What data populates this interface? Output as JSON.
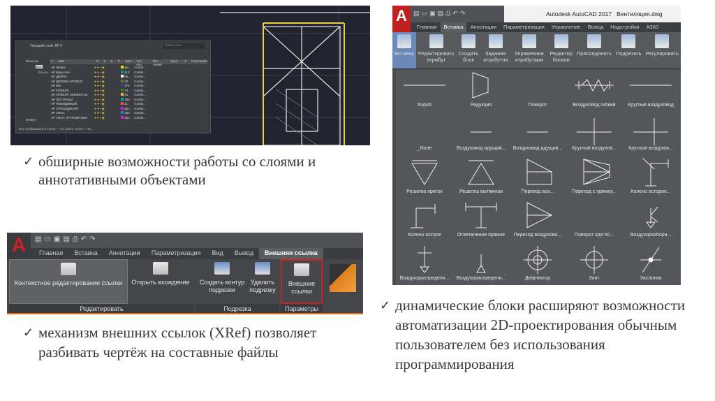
{
  "layers_panel": {
    "title": "Текущий слой: АР 0",
    "search_placeholder": "Поиск слоя",
    "filter_header": "Фильтры",
    "filter_all": "Все",
    "filter_used": "Все ис...",
    "invert_label": "Инверт",
    "columns": [
      "С.",
      "Имя",
      "В.",
      "З.",
      "Б.",
      "П.",
      "Цвет",
      "Тип лин...",
      "Вес линий",
      "Проз...",
      "З.",
      "Пояснение"
    ],
    "rows": [
      {
        "name": "АР Мебел",
        "color": "#e8e800",
        "color_label": "же..."
      },
      {
        "name": "АР Ведостен",
        "color": "#00a080",
        "color_label": "112"
      },
      {
        "name": "АР ДВЕРИ",
        "color": "#ffffff",
        "color_label": "бе..."
      },
      {
        "name": "АР ДЕРЕВО КРОВЛЯ",
        "color": "#8a6a30",
        "color_label": "33"
      },
      {
        "name": "АР ВЫ",
        "color": "#3040a0",
        "color_label": "171"
      },
      {
        "name": "АР КРОВЛЯ",
        "color": "#2a8a20",
        "color_label": "74"
      },
      {
        "name": "АР КРОВЛЯ ЭЛЕМЕНТЫ",
        "color": "#e0c040",
        "color_label": "41"
      },
      {
        "name": "АР ЛЕСТНИЦА",
        "color": "#00a0b0",
        "color_label": "152"
      },
      {
        "name": "АР НЕВИДИМЫЙ",
        "color": "#e05050",
        "color_label": "11"
      },
      {
        "name": "АР ОГРАЖДЕНИЯ",
        "color": "#d020d0",
        "color_label": "фи..."
      },
      {
        "name": "АР ОКНА",
        "color": "#2080d0",
        "color_label": "150"
      },
      {
        "name": "АР ОКНА ОТКРЫВАНИЕ",
        "color": "#d020d0",
        "color_label": "фи..."
      }
    ],
    "linetype": "Contin...",
    "status": "Все отображаются слоев — 81, всего слоев — 81"
  },
  "bullets": {
    "layers": "обширные возможности работы со слоями и аннотативными объектами",
    "xref": "механизм внешних ссылок (XRef) позволяет разбивать чертёж на составные файлы",
    "blocks": "динамические блоки расширяют возможности автоматизации 2D-проектирования обычным пользователем без использования программирования"
  },
  "acad": {
    "title": "Autodesk AutoCAD 2017",
    "file": "Вентиляция.dwg",
    "tabs": [
      "Главная",
      "Вставка",
      "Аннотации",
      "Параметризация",
      "Управление",
      "Вывод",
      "Надстройки",
      "А360"
    ],
    "ribbon": [
      "Вставка",
      "Редактировать атрибут",
      "Создать блок",
      "Задание атрибутов",
      "Управление атрибутами",
      "Редактор блоков",
      "Присоединить",
      "Подрезать",
      "Регулировать"
    ],
    "blocks": [
      "Короб",
      "Редукция",
      "Поворот",
      "Воздуховод гибкий",
      "Круглый воздуховод",
      "_None",
      "Воздуховод идущий...",
      "Воздуховод идущий...",
      "Круглый воздухов...",
      "Круглый воздухов...",
      "Решотка приток",
      "Решотка вытяжная",
      "Переход аси...",
      "Переход с прямоу...",
      "Колено осторое...",
      "Колено острое",
      "Ответвление прямое",
      "Переход воздухово...",
      "Поворот кругло...",
      "Воздухоразборн...",
      "Воздухораспредели...",
      "Воздухораспредели...",
      "Дефлектор",
      "Зонт",
      "Заслонка"
    ]
  },
  "xref": {
    "tabs": [
      "Главная",
      "Вставка",
      "Аннотации",
      "Параметризация",
      "Вид",
      "Вывод",
      "Внешняя ссылка"
    ],
    "buttons": [
      "Контекстное редактирование ссылки",
      "Открыть вхождение",
      "Создать контур подрезки",
      "Удалить подрезку",
      "Внешние ссылки"
    ],
    "groups": [
      "Редактировать",
      "Подрезка",
      "Параметры"
    ],
    "highlight_color": "#d42020"
  }
}
